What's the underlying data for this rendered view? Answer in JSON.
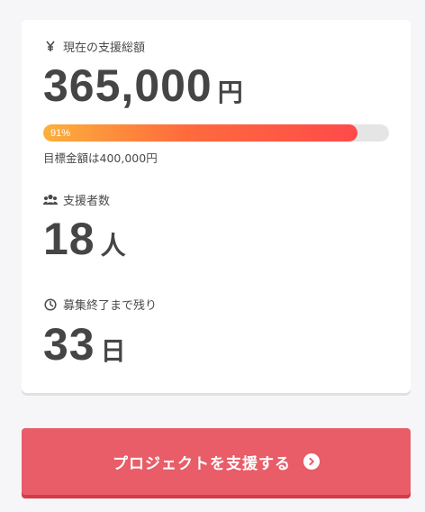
{
  "funding": {
    "label": "現在の支援総額",
    "amount": "365,000",
    "unit": "円",
    "progress_text": "91%",
    "progress_fraction": 0.91,
    "goal_text": "目標金額は400,000円"
  },
  "supporters": {
    "label": "支援者数",
    "count": "18",
    "unit": "人"
  },
  "remaining": {
    "label": "募集終了まで残り",
    "days": "33",
    "unit": "日"
  },
  "cta": {
    "label": "プロジェクトを支援する"
  },
  "icons": {
    "funding": "yen-icon",
    "supporters": "users-icon",
    "remaining": "clock-icon",
    "cta": "chevron-circle-right-icon"
  },
  "colors": {
    "button": "#e85d68",
    "progress_start": "#fbb03b",
    "progress_end": "#ff4a4a",
    "text": "#454545"
  }
}
